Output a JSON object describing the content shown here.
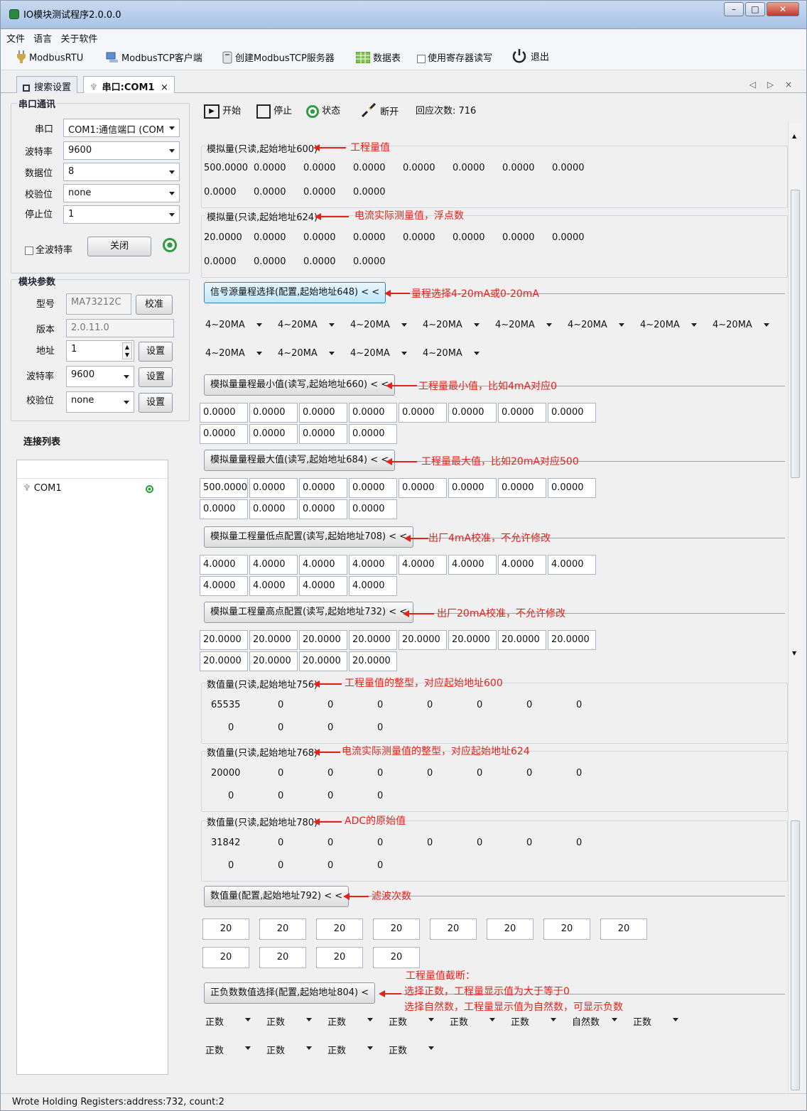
{
  "window": {
    "title": "IO模块测试程序2.0.0.0"
  },
  "menu": [
    "文件",
    "语言",
    "关于软件"
  ],
  "toolbar": {
    "modbus_rtu": "ModbusRTU",
    "tcp_client": "ModbusTCP客户端",
    "tcp_server": "创建ModbusTCP服务器",
    "datatable": "数据表",
    "use_register": "使用寄存器读写",
    "exit": "退出"
  },
  "tabs": {
    "search": "搜索设置",
    "com": "串口:COM1",
    "close": "×",
    "nav": "◁ ▷ ×"
  },
  "serial": {
    "group_title": "串口通讯",
    "port_label": "串口",
    "port_value": "COM1:通信端口 (COM",
    "baud_label": "波特率",
    "baud_value": "9600",
    "databits_label": "数据位",
    "databits_value": "8",
    "parity_label": "校验位",
    "parity_value": "none",
    "stopbits_label": "停止位",
    "stopbits_value": "1",
    "all_baud": "全波特率",
    "close_btn": "关闭"
  },
  "module": {
    "group_title": "模块参数",
    "model_label": "型号",
    "model_value": "MA73212C",
    "calib_btn": "校准",
    "version_label": "版本",
    "version_value": "2.0.11.0",
    "addr_label": "地址",
    "addr_value": "1",
    "addr_set": "设置",
    "baud_label": "波特率",
    "baud_value": "9600",
    "baud_set": "设置",
    "parity_label": "校验位",
    "parity_value": "none",
    "parity_set": "设置"
  },
  "connections": {
    "title": "连接列表",
    "items": [
      "COM1"
    ]
  },
  "right_toolbar": {
    "start": "开始",
    "stop": "停止",
    "state": "状态",
    "disconnect": "断开",
    "reply_count": "回应次数: 716"
  },
  "sections": {
    "s600": {
      "title": "模拟量(只读,起始地址600)",
      "ann": "工程量值",
      "row1": [
        "500.0000",
        "0.0000",
        "0.0000",
        "0.0000",
        "0.0000",
        "0.0000",
        "0.0000",
        "0.0000"
      ],
      "row2": [
        "0.0000",
        "0.0000",
        "0.0000",
        "0.0000"
      ]
    },
    "s624": {
      "title": "模拟量(只读,起始地址624)",
      "ann": "电流实际测量值，浮点数",
      "row1": [
        "20.0000",
        "0.0000",
        "0.0000",
        "0.0000",
        "0.0000",
        "0.0000",
        "0.0000",
        "0.0000"
      ],
      "row2": [
        "0.0000",
        "0.0000",
        "0.0000",
        "0.0000"
      ]
    },
    "s648": {
      "btn": "信号源量程选择(配置,起始地址648) < <",
      "ann": "量程选择4-20mA或0-20mA",
      "row1": [
        "4~20MA",
        "4~20MA",
        "4~20MA",
        "4~20MA",
        "4~20MA",
        "4~20MA",
        "4~20MA",
        "4~20MA"
      ],
      "row2": [
        "4~20MA",
        "4~20MA",
        "4~20MA",
        "4~20MA"
      ]
    },
    "s660": {
      "btn": "模拟量量程最小值(读写,起始地址660) < <",
      "ann": "工程量最小值，比如4mA对应0",
      "row1": [
        "0.0000",
        "0.0000",
        "0.0000",
        "0.0000",
        "0.0000",
        "0.0000",
        "0.0000",
        "0.0000"
      ],
      "row2": [
        "0.0000",
        "0.0000",
        "0.0000",
        "0.0000"
      ]
    },
    "s684": {
      "btn": "模拟量量程最大值(读写,起始地址684) < <",
      "ann": "工程量最大值，比如20mA对应500",
      "row1": [
        "500.0000",
        "0.0000",
        "0.0000",
        "0.0000",
        "0.0000",
        "0.0000",
        "0.0000",
        "0.0000"
      ],
      "row2": [
        "0.0000",
        "0.0000",
        "0.0000",
        "0.0000"
      ]
    },
    "s708": {
      "btn": "模拟量工程量低点配置(读写,起始地址708) < <",
      "ann": "出厂4mA校准，不允许修改",
      "row1": [
        "4.0000",
        "4.0000",
        "4.0000",
        "4.0000",
        "4.0000",
        "4.0000",
        "4.0000",
        "4.0000"
      ],
      "row2": [
        "4.0000",
        "4.0000",
        "4.0000",
        "4.0000"
      ]
    },
    "s732": {
      "btn": "模拟量工程量高点配置(读写,起始地址732) < <",
      "ann": "出厂20mA校准，不允许修改",
      "row1": [
        "20.0000",
        "20.0000",
        "20.0000",
        "20.0000",
        "20.0000",
        "20.0000",
        "20.0000",
        "20.0000"
      ],
      "row2": [
        "20.0000",
        "20.0000",
        "20.0000",
        "20.0000"
      ]
    },
    "s756": {
      "title": "数值量(只读,起始地址756)",
      "ann": "工程量值的整型，对应起始地址600",
      "row1": [
        "65535",
        "0",
        "0",
        "0",
        "0",
        "0",
        "0",
        "0"
      ],
      "row2": [
        "0",
        "0",
        "0",
        "0"
      ]
    },
    "s768": {
      "title": "数值量(只读,起始地址768)",
      "ann": "电流实际测量值的整型，对应起始地址624",
      "row1": [
        "20000",
        "0",
        "0",
        "0",
        "0",
        "0",
        "0",
        "0"
      ],
      "row2": [
        "0",
        "0",
        "0",
        "0"
      ]
    },
    "s780": {
      "title": "数值量(只读,起始地址780)",
      "ann": "ADC的原始值",
      "row1": [
        "31842",
        "0",
        "0",
        "0",
        "0",
        "0",
        "0",
        "0"
      ],
      "row2": [
        "0",
        "0",
        "0",
        "0"
      ]
    },
    "s792": {
      "btn": "数值量(配置,起始地址792) < <",
      "ann": "滤波次数",
      "row1": [
        "20",
        "20",
        "20",
        "20",
        "20",
        "20",
        "20",
        "20"
      ],
      "row2": [
        "20",
        "20",
        "20",
        "20"
      ]
    },
    "s804": {
      "btn": "正负数数值选择(配置,起始地址804) <",
      "ann1": "工程量值截断：",
      "ann2": "选择正数，工程量显示值为大于等于0",
      "ann3": "选择自然数，工程量显示值为自然数，可显示负数",
      "row1": [
        "正数",
        "正数",
        "正数",
        "正数",
        "正数",
        "正数",
        "自然数",
        "正数"
      ],
      "row2": [
        "正数",
        "正数",
        "正数",
        "正数"
      ]
    }
  },
  "status": "Wrote Holding Registers:address:732, count:2",
  "colors": {
    "annotation": "#e2231a",
    "status_green": "#2e9e3e"
  }
}
